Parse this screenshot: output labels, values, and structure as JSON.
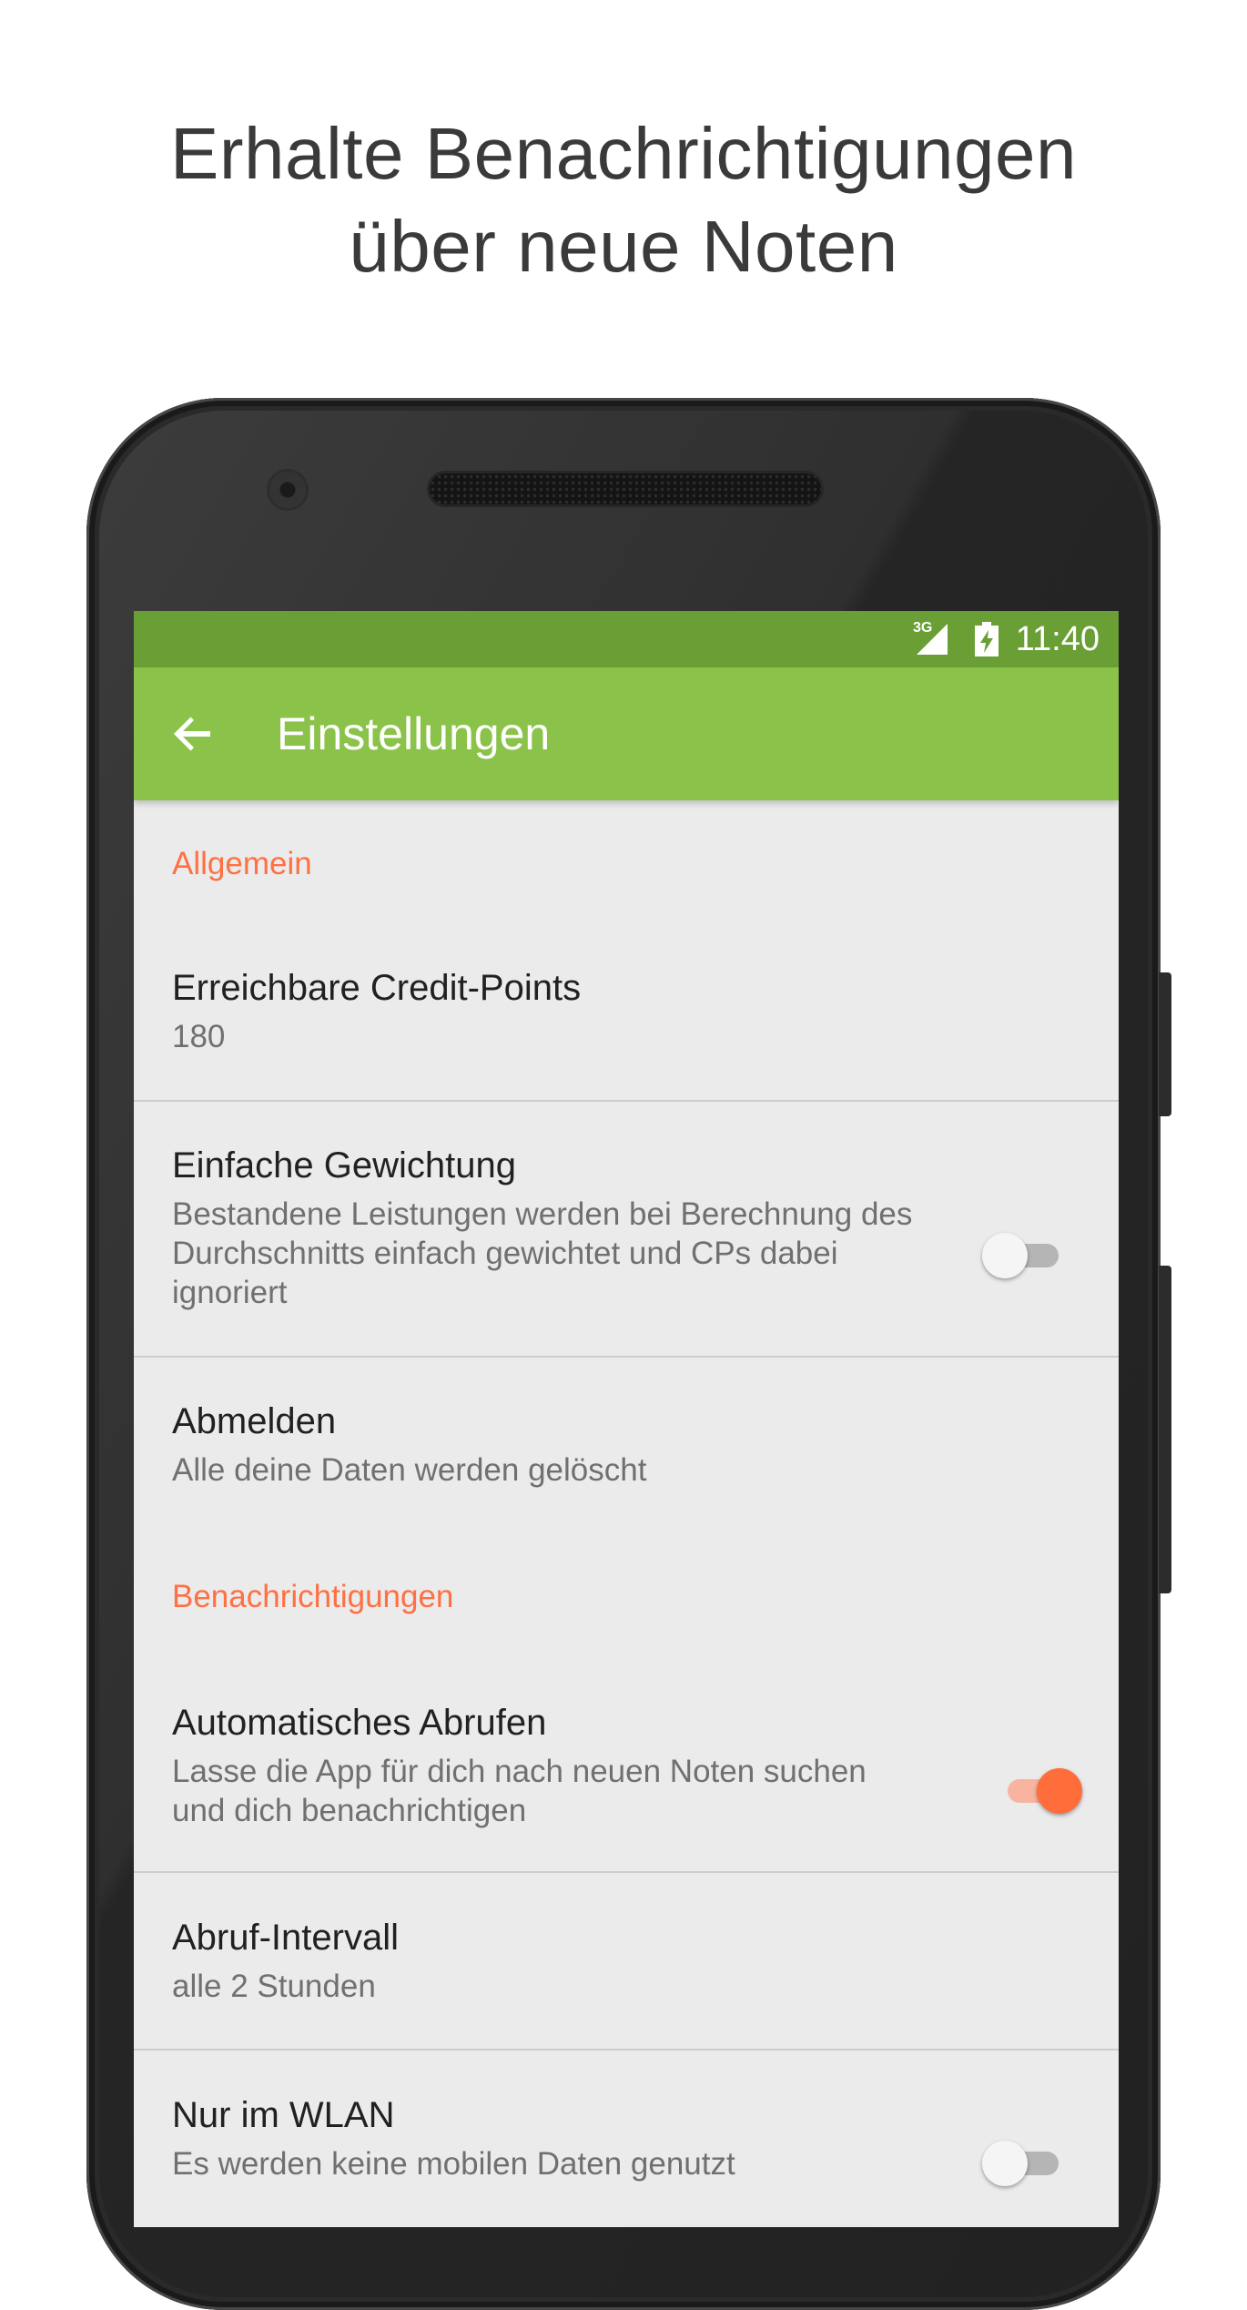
{
  "promo": {
    "line1": "Erhalte Benachrichtigungen",
    "line2": "über neue Noten"
  },
  "status_bar": {
    "network": "3G",
    "time": "11:40",
    "icons": [
      "signal-icon",
      "battery-charging-icon"
    ]
  },
  "app_bar": {
    "back_icon": "arrow-back-icon",
    "title": "Einstellungen",
    "color": "#8bc34a"
  },
  "accent_color": "#ff7043",
  "sections": [
    {
      "header": "Allgemein",
      "items": [
        {
          "title": "Erreichbare Credit-Points",
          "summary": "180"
        },
        {
          "title": "Einfache Gewichtung",
          "summary_lines": [
            "Bestandene Leistungen werden bei Berechnung des",
            "Durchschnitts einfach gewichtet und CPs dabei",
            "ignoriert"
          ],
          "switch_on": false
        },
        {
          "title": "Abmelden",
          "summary": "Alle deine Daten werden gelöscht"
        }
      ]
    },
    {
      "header": "Benachrichtigungen",
      "items": [
        {
          "title": "Automatisches Abrufen",
          "summary_lines": [
            "Lasse die App für dich nach neuen Noten suchen",
            "und dich benachrichtigen"
          ],
          "switch_on": true
        },
        {
          "title": "Abruf-Intervall",
          "summary": "alle 2 Stunden"
        },
        {
          "title": "Nur im WLAN",
          "summary": "Es werden keine mobilen Daten genutzt",
          "switch_on": false
        }
      ]
    }
  ]
}
